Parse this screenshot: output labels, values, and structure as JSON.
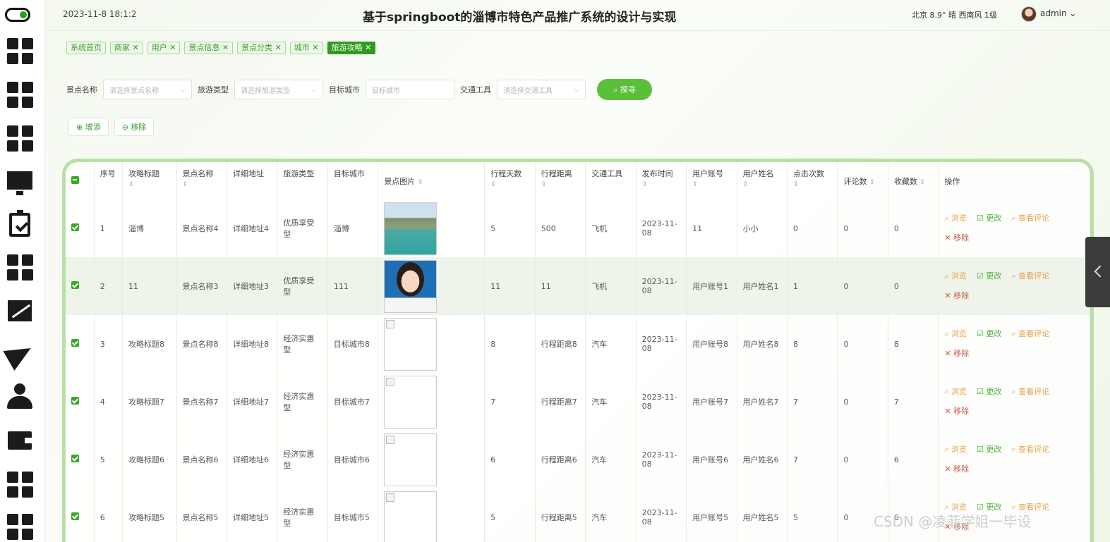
{
  "header": {
    "datetime": "2023-11-8 18:1:2",
    "title": "基于springboot的淄博市特色产品推广系统的设计与实现",
    "weather": "北京  8.9°  晴  西南风  1级",
    "user": "admin ⌄"
  },
  "tags": [
    {
      "label": "系统首页"
    },
    {
      "label": "商家 ✕"
    },
    {
      "label": "用户 ✕"
    },
    {
      "label": "景点信息 ✕"
    },
    {
      "label": "景点分类 ✕"
    },
    {
      "label": "城市 ✕"
    },
    {
      "label": "旅游攻略 ✕"
    }
  ],
  "search": {
    "spot_label": "景点名称",
    "spot_placeholder": "请选择景点名称",
    "type_label": "旅游类型",
    "type_placeholder": "请选择旅游类型",
    "city_label": "目标城市",
    "city_placeholder": "目标城市",
    "traffic_label": "交通工具",
    "traffic_placeholder": "请选择交通工具",
    "button": "⌕ 探寻"
  },
  "actions": {
    "add": "⊕ 增添",
    "remove": "⊖ 移除"
  },
  "table": {
    "headers": [
      "序号",
      "攻略标题",
      "景点名称",
      "详细地址",
      "旅游类型",
      "目标城市",
      "景点图片",
      "行程天数",
      "行程距离",
      "交通工具",
      "发布时间",
      "用户账号",
      "用户姓名",
      "点击次数",
      "评论数",
      "收藏数",
      "操作"
    ],
    "rows": [
      {
        "no": "1",
        "title": "淄博",
        "spot": "景点名称4",
        "addr": "详细地址4",
        "type": "优质享受型",
        "city": "淄博",
        "img": "lake",
        "days": "5",
        "dist": "500",
        "traffic": "飞机",
        "time": "2023-11-08",
        "account": "11",
        "name": "小小",
        "clicks": "0",
        "comments": "0",
        "favs": "0"
      },
      {
        "no": "2",
        "title": "11",
        "spot": "景点名称3",
        "addr": "详细地址3",
        "type": "优质享受型",
        "city": "111",
        "img": "person",
        "days": "11",
        "dist": "11",
        "traffic": "飞机",
        "time": "2023-11-08",
        "account": "用户账号1",
        "name": "用户姓名1",
        "clicks": "1",
        "comments": "0",
        "favs": "0"
      },
      {
        "no": "3",
        "title": "攻略标题8",
        "spot": "景点名称8",
        "addr": "详细地址8",
        "type": "经济实惠型",
        "city": "目标城市8",
        "img": "broken",
        "days": "8",
        "dist": "行程距离8",
        "traffic": "汽车",
        "time": "2023-11-08",
        "account": "用户账号8",
        "name": "用户姓名8",
        "clicks": "8",
        "comments": "0",
        "favs": "8"
      },
      {
        "no": "4",
        "title": "攻略标题7",
        "spot": "景点名称7",
        "addr": "详细地址7",
        "type": "经济实惠型",
        "city": "目标城市7",
        "img": "broken",
        "days": "7",
        "dist": "行程距离7",
        "traffic": "汽车",
        "time": "2023-11-08",
        "account": "用户账号7",
        "name": "用户姓名7",
        "clicks": "7",
        "comments": "0",
        "favs": "7"
      },
      {
        "no": "5",
        "title": "攻略标题6",
        "spot": "景点名称6",
        "addr": "详细地址6",
        "type": "经济实惠型",
        "city": "目标城市6",
        "img": "broken",
        "days": "6",
        "dist": "行程距离6",
        "traffic": "汽车",
        "time": "2023-11-08",
        "account": "用户账号6",
        "name": "用户姓名6",
        "clicks": "7",
        "comments": "0",
        "favs": "6"
      },
      {
        "no": "6",
        "title": "攻略标题5",
        "spot": "景点名称5",
        "addr": "详细地址5",
        "type": "经济实惠型",
        "city": "目标城市5",
        "img": "broken",
        "days": "5",
        "dist": "行程距离5",
        "traffic": "汽车",
        "time": "2023-11-08",
        "account": "用户账号5",
        "name": "用户姓名5",
        "clicks": "5",
        "comments": "0",
        "favs": "6"
      }
    ],
    "op_view": "⌕ 浏览",
    "op_edit": "☑ 更改",
    "op_comments": "⌕ 查看评论",
    "op_delete": "✕ 移除"
  },
  "watermark": "CSDN @凌菲学姐一毕设",
  "colors": {
    "accent": "#5bbf3a",
    "tag_active": "#2e9b1e",
    "table_border": "#b8e0a5"
  }
}
